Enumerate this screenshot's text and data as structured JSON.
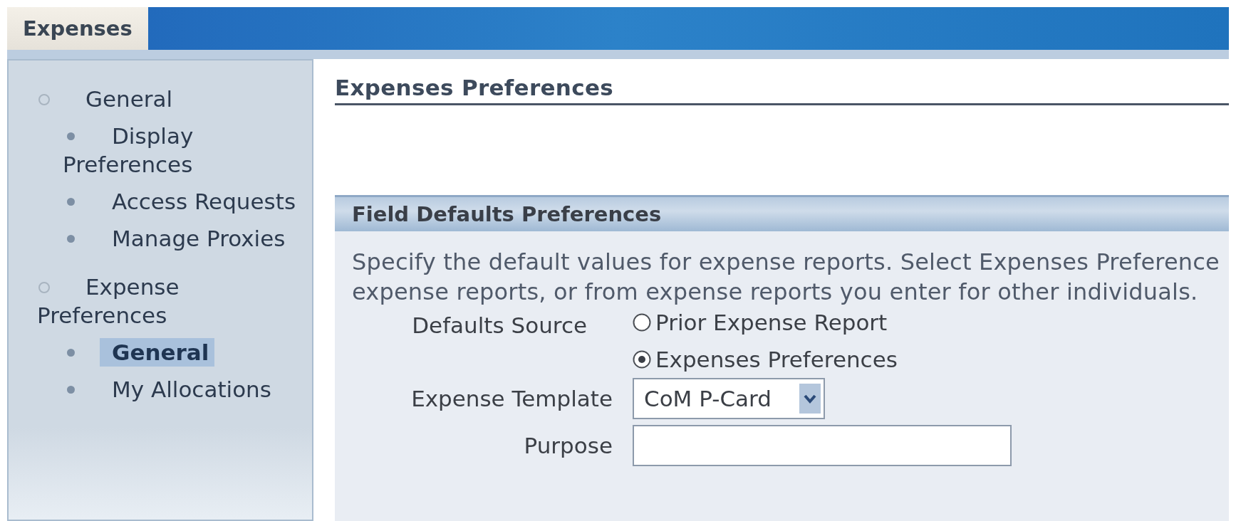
{
  "tab": {
    "label": "Expenses",
    "selected": true
  },
  "sidebar": {
    "groups": [
      {
        "label": "General",
        "children": [
          {
            "label": "Display Preferences",
            "selected": false
          },
          {
            "label": "Access Requests",
            "selected": false
          },
          {
            "label": "Manage Proxies",
            "selected": false
          }
        ]
      },
      {
        "label": "Expense Preferences",
        "children": [
          {
            "label": "General",
            "selected": true
          },
          {
            "label": "My Allocations",
            "selected": false
          }
        ]
      }
    ]
  },
  "page_title": "Expenses Preferences",
  "section": {
    "title": "Field Defaults Preferences",
    "description_lines": [
      "Specify the default values for expense reports. Select Expenses Preference",
      "expense reports, or from expense reports you enter for other individuals."
    ],
    "fields": [
      {
        "kind": "radio",
        "label": "Defaults Source",
        "options": [
          {
            "label": "Prior Expense Report",
            "selected": false
          },
          {
            "label": "Expenses Preferences",
            "selected": true
          }
        ]
      },
      {
        "kind": "select",
        "label": "Expense Template",
        "value": "CoM P-Card"
      },
      {
        "kind": "text",
        "label": "Purpose"
      }
    ]
  }
}
